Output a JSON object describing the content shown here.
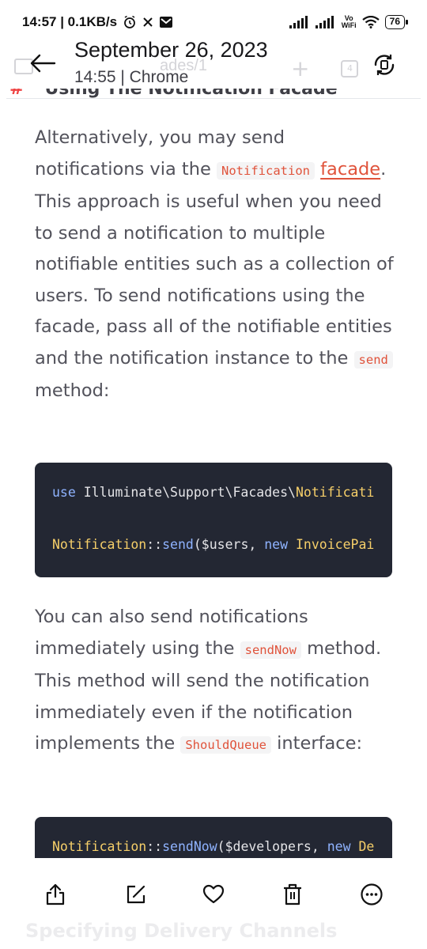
{
  "status_bar": {
    "time_and_speed": "14:57 | 0.1KB/s",
    "vowifi_top": "Vo",
    "vowifi_bottom": "WiFi",
    "battery": "76"
  },
  "header": {
    "date": "September 26, 2023",
    "subtitle": "14:55 | Chrome",
    "ghost_url": "ades/1",
    "ghost_tab_count": "4"
  },
  "cut_heading": {
    "hash": "#",
    "text": "Using The Notification Facade"
  },
  "paragraph1": {
    "t1": "Alternatively, you may send notifications via the ",
    "code1": "Notification",
    "t2": " ",
    "link": "facade",
    "t3": ". This approach is useful when you need to send a notification to multiple notifiable entities such as a collection of users. To send notifications using the facade, pass all of the notifiable entities and the notification instance to the ",
    "code2": "send",
    "t4": " method:"
  },
  "code_block_1": {
    "line1": {
      "keyword": "use",
      "namespace": " Illuminate\\Support\\Facades\\",
      "class": "Notificati"
    },
    "line2": {
      "class": "Notification",
      "op": "::",
      "method": "send",
      "args": "($users, ",
      "keyword": "new",
      "class2": " InvoicePai"
    }
  },
  "paragraph2": {
    "t1": "You can also send notifications immediately using the ",
    "code1": "sendNow",
    "t2": " method. This method will send the notification immediately even if the notification implements the ",
    "code2": "ShouldQueue",
    "t3": " interface:"
  },
  "code_block_2": {
    "line1": {
      "class": "Notification",
      "op": "::",
      "method": "sendNow",
      "args": "($developers, ",
      "keyword": "new",
      "class2": " De"
    }
  },
  "next_heading_ghost": "Specifying Delivery Channels",
  "action_bar": {
    "icons": [
      "share-icon",
      "edit-icon",
      "heart-icon",
      "delete-icon",
      "more-icon"
    ]
  },
  "colors": {
    "code_background": "#232733",
    "inline_code_text": "#e0533b",
    "link": "#e0533b",
    "body_text": "#52525b",
    "keyword": "#8fb3ff",
    "class_name": "#f6cf69"
  }
}
